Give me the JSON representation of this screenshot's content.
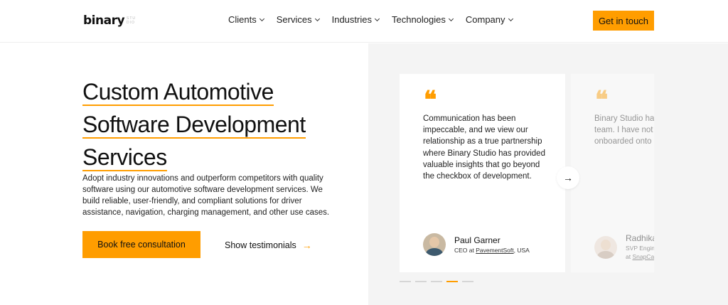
{
  "header": {
    "logo": "binary",
    "logo_sub": [
      "STU",
      "DIO"
    ],
    "nav": [
      {
        "label": "Clients"
      },
      {
        "label": "Services"
      },
      {
        "label": "Industries"
      },
      {
        "label": "Technologies"
      },
      {
        "label": "Company"
      }
    ],
    "cta_label": "Get in touch"
  },
  "hero": {
    "title_lines": [
      "Custom Automotive",
      "Software Development",
      "Services"
    ],
    "description": "Adopt industry innovations and outperform competitors with quality software using our automotive software development services. We build reliable, user-friendly, and compliant solutions for driver assistance, navigation, charging management, and other use cases.",
    "primary_button": "Book free consultation",
    "secondary_button": "Show testimonials"
  },
  "testimonials": {
    "items": [
      {
        "quote": "Communication has been impeccable, and we view our relationship as a true partnership where Binary Studio has provided valuable insights that go beyond the checkbox of development.",
        "name": "Paul Garner",
        "role_prefix": "CEO at ",
        "company": "PavementSoft",
        "role_suffix": ", USA"
      },
      {
        "quote": "Binary Studio ha hiring process, a team. I have not person who has onboarded onto not able to help",
        "name": "Radhika",
        "role_prefix": "SVP Engin",
        "company": "SnapCa",
        "role_suffix": ""
      }
    ],
    "dot_count": 5,
    "active_dot": 3
  },
  "colors": {
    "accent": "#ff9d00",
    "panel_bg": "#f4f4f4"
  }
}
